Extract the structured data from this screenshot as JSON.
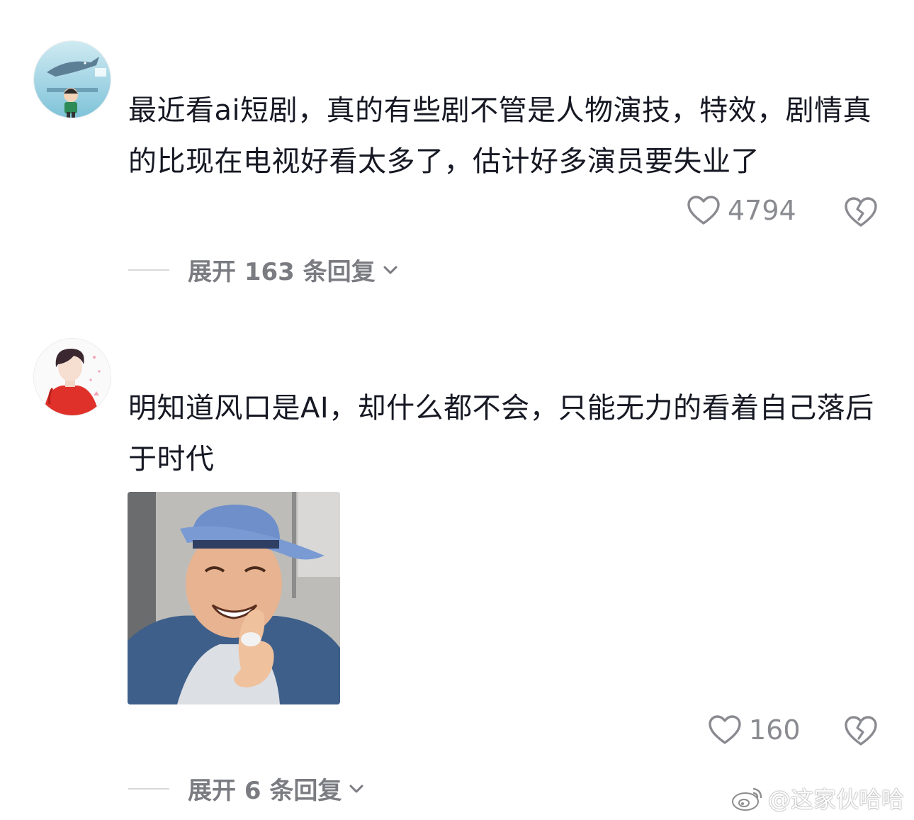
{
  "comments": [
    {
      "text": "最近看ai短剧，真的有些剧不管是人物演技，特效，剧情真的比现在电视好看太多了，估计好多演员要失业了",
      "likes": "4794",
      "replies_label": "展开 163 条回复"
    },
    {
      "text": "明知道风口是AI，却什么都不会，只能无力的看着自己落后于时代",
      "likes": "160",
      "replies_label": "展开 6 条回复"
    }
  ],
  "watermark": {
    "text": "@这家伙哈哈"
  },
  "icons": {
    "like": "heart-outline-icon",
    "dislike": "broken-heart-icon",
    "expand": "chevron-down-icon",
    "watermark_logo": "weibo-logo-icon"
  },
  "colors": {
    "text": "#161823",
    "muted": "#8a8b91",
    "background": "#ffffff"
  }
}
